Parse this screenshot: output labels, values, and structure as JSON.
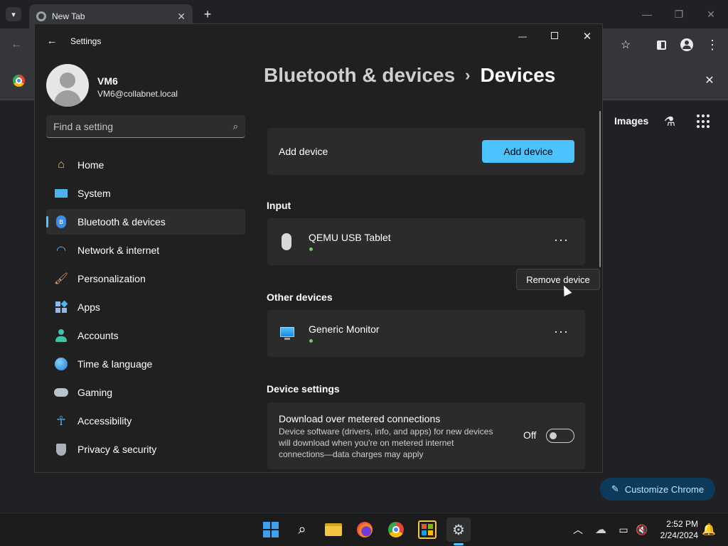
{
  "browser": {
    "tab_title": "New Tab",
    "images_label": "Images",
    "customize_label": "Customize Chrome"
  },
  "settings": {
    "window_title": "Settings",
    "user": {
      "name": "VM6",
      "email": "VM6@collabnet.local"
    },
    "search_placeholder": "Find a setting",
    "nav": [
      {
        "label": "Home",
        "icon": "home-icon"
      },
      {
        "label": "System",
        "icon": "system-icon"
      },
      {
        "label": "Bluetooth & devices",
        "icon": "bluetooth-icon",
        "active": true
      },
      {
        "label": "Network & internet",
        "icon": "wifi-icon"
      },
      {
        "label": "Personalization",
        "icon": "brush-icon"
      },
      {
        "label": "Apps",
        "icon": "apps-icon"
      },
      {
        "label": "Accounts",
        "icon": "accounts-icon"
      },
      {
        "label": "Time & language",
        "icon": "globe-icon"
      },
      {
        "label": "Gaming",
        "icon": "gamepad-icon"
      },
      {
        "label": "Accessibility",
        "icon": "accessibility-icon"
      },
      {
        "label": "Privacy & security",
        "icon": "shield-icon"
      }
    ],
    "breadcrumb": {
      "parent": "Bluetooth & devices",
      "separator": "›",
      "current": "Devices"
    },
    "add_device": {
      "label": "Add device",
      "button": "Add device"
    },
    "input_section": {
      "heading": "Input",
      "device_name": "QEMU USB Tablet"
    },
    "other_section": {
      "heading": "Other devices",
      "device_name": "Generic Monitor"
    },
    "tooltip": "Remove device",
    "device_settings": {
      "heading": "Device settings",
      "metered_title": "Download over metered connections",
      "metered_desc_1": "Device software (drivers, info, and apps) for new devices",
      "metered_desc_2": "will download when you're on metered internet",
      "metered_desc_3": "connections—data charges may apply",
      "toggle_label": "Off"
    }
  },
  "taskbar": {
    "time": "2:52 PM",
    "date": "2/24/2024"
  },
  "colors": {
    "accent": "#4cc2ff",
    "status_green": "#6ccb5f"
  }
}
